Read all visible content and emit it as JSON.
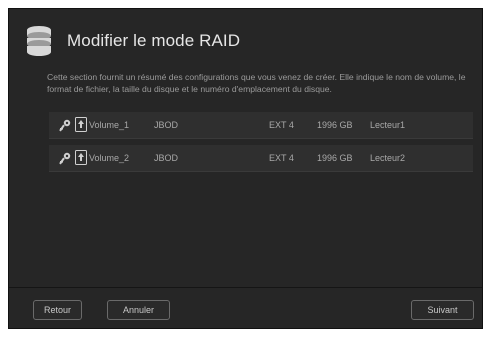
{
  "header": {
    "title": "Modifier le mode RAID",
    "icon": "database-icon"
  },
  "description": "Cette section fournit un résumé des configurations que vous venez de créer. Elle indique le nom de volume, le format de fichier, la taille du disque et le numéro d'emplacement du disque.",
  "volumes": [
    {
      "name": "Volume_1",
      "raid_format": "JBOD",
      "file_system": "EXT 4",
      "size": "1996 GB",
      "slot": "Lecteur1",
      "icons": [
        "key-icon",
        "volume-icon"
      ]
    },
    {
      "name": "Volume_2",
      "raid_format": "JBOD",
      "file_system": "EXT 4",
      "size": "1996 GB",
      "slot": "Lecteur2",
      "icons": [
        "key-icon",
        "volume-icon"
      ]
    }
  ],
  "footer": {
    "back_label": "Retour",
    "cancel_label": "Annuler",
    "next_label": "Suivant"
  },
  "colors": {
    "background": "#262626",
    "row_background": "#2f2f2f",
    "text": "#a8a8a8"
  }
}
